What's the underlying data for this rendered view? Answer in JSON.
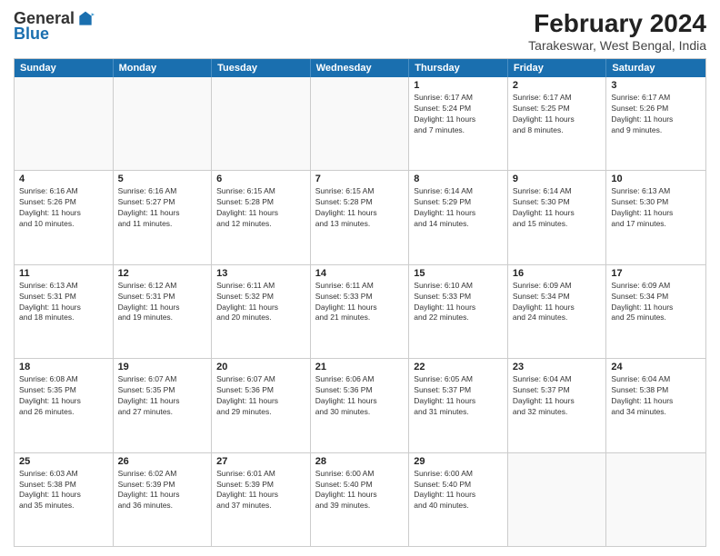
{
  "header": {
    "logo_general": "General",
    "logo_blue": "Blue",
    "month_year": "February 2024",
    "location": "Tarakeswar, West Bengal, India"
  },
  "weekdays": [
    "Sunday",
    "Monday",
    "Tuesday",
    "Wednesday",
    "Thursday",
    "Friday",
    "Saturday"
  ],
  "weeks": [
    [
      {
        "day": "",
        "info": "",
        "empty": true
      },
      {
        "day": "",
        "info": "",
        "empty": true
      },
      {
        "day": "",
        "info": "",
        "empty": true
      },
      {
        "day": "",
        "info": "",
        "empty": true
      },
      {
        "day": "1",
        "info": "Sunrise: 6:17 AM\nSunset: 5:24 PM\nDaylight: 11 hours\nand 7 minutes."
      },
      {
        "day": "2",
        "info": "Sunrise: 6:17 AM\nSunset: 5:25 PM\nDaylight: 11 hours\nand 8 minutes."
      },
      {
        "day": "3",
        "info": "Sunrise: 6:17 AM\nSunset: 5:26 PM\nDaylight: 11 hours\nand 9 minutes."
      }
    ],
    [
      {
        "day": "4",
        "info": "Sunrise: 6:16 AM\nSunset: 5:26 PM\nDaylight: 11 hours\nand 10 minutes."
      },
      {
        "day": "5",
        "info": "Sunrise: 6:16 AM\nSunset: 5:27 PM\nDaylight: 11 hours\nand 11 minutes."
      },
      {
        "day": "6",
        "info": "Sunrise: 6:15 AM\nSunset: 5:28 PM\nDaylight: 11 hours\nand 12 minutes."
      },
      {
        "day": "7",
        "info": "Sunrise: 6:15 AM\nSunset: 5:28 PM\nDaylight: 11 hours\nand 13 minutes."
      },
      {
        "day": "8",
        "info": "Sunrise: 6:14 AM\nSunset: 5:29 PM\nDaylight: 11 hours\nand 14 minutes."
      },
      {
        "day": "9",
        "info": "Sunrise: 6:14 AM\nSunset: 5:30 PM\nDaylight: 11 hours\nand 15 minutes."
      },
      {
        "day": "10",
        "info": "Sunrise: 6:13 AM\nSunset: 5:30 PM\nDaylight: 11 hours\nand 17 minutes."
      }
    ],
    [
      {
        "day": "11",
        "info": "Sunrise: 6:13 AM\nSunset: 5:31 PM\nDaylight: 11 hours\nand 18 minutes."
      },
      {
        "day": "12",
        "info": "Sunrise: 6:12 AM\nSunset: 5:31 PM\nDaylight: 11 hours\nand 19 minutes."
      },
      {
        "day": "13",
        "info": "Sunrise: 6:11 AM\nSunset: 5:32 PM\nDaylight: 11 hours\nand 20 minutes."
      },
      {
        "day": "14",
        "info": "Sunrise: 6:11 AM\nSunset: 5:33 PM\nDaylight: 11 hours\nand 21 minutes."
      },
      {
        "day": "15",
        "info": "Sunrise: 6:10 AM\nSunset: 5:33 PM\nDaylight: 11 hours\nand 22 minutes."
      },
      {
        "day": "16",
        "info": "Sunrise: 6:09 AM\nSunset: 5:34 PM\nDaylight: 11 hours\nand 24 minutes."
      },
      {
        "day": "17",
        "info": "Sunrise: 6:09 AM\nSunset: 5:34 PM\nDaylight: 11 hours\nand 25 minutes."
      }
    ],
    [
      {
        "day": "18",
        "info": "Sunrise: 6:08 AM\nSunset: 5:35 PM\nDaylight: 11 hours\nand 26 minutes."
      },
      {
        "day": "19",
        "info": "Sunrise: 6:07 AM\nSunset: 5:35 PM\nDaylight: 11 hours\nand 27 minutes."
      },
      {
        "day": "20",
        "info": "Sunrise: 6:07 AM\nSunset: 5:36 PM\nDaylight: 11 hours\nand 29 minutes."
      },
      {
        "day": "21",
        "info": "Sunrise: 6:06 AM\nSunset: 5:36 PM\nDaylight: 11 hours\nand 30 minutes."
      },
      {
        "day": "22",
        "info": "Sunrise: 6:05 AM\nSunset: 5:37 PM\nDaylight: 11 hours\nand 31 minutes."
      },
      {
        "day": "23",
        "info": "Sunrise: 6:04 AM\nSunset: 5:37 PM\nDaylight: 11 hours\nand 32 minutes."
      },
      {
        "day": "24",
        "info": "Sunrise: 6:04 AM\nSunset: 5:38 PM\nDaylight: 11 hours\nand 34 minutes."
      }
    ],
    [
      {
        "day": "25",
        "info": "Sunrise: 6:03 AM\nSunset: 5:38 PM\nDaylight: 11 hours\nand 35 minutes."
      },
      {
        "day": "26",
        "info": "Sunrise: 6:02 AM\nSunset: 5:39 PM\nDaylight: 11 hours\nand 36 minutes."
      },
      {
        "day": "27",
        "info": "Sunrise: 6:01 AM\nSunset: 5:39 PM\nDaylight: 11 hours\nand 37 minutes."
      },
      {
        "day": "28",
        "info": "Sunrise: 6:00 AM\nSunset: 5:40 PM\nDaylight: 11 hours\nand 39 minutes."
      },
      {
        "day": "29",
        "info": "Sunrise: 6:00 AM\nSunset: 5:40 PM\nDaylight: 11 hours\nand 40 minutes."
      },
      {
        "day": "",
        "info": "",
        "empty": true
      },
      {
        "day": "",
        "info": "",
        "empty": true
      }
    ]
  ]
}
